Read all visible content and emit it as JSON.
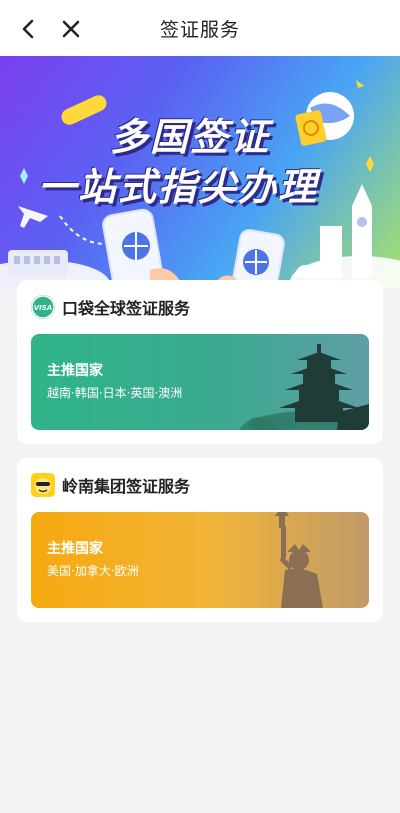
{
  "nav": {
    "title": "签证服务"
  },
  "banner": {
    "line1": "多国签证",
    "line2": "一站式指尖办理"
  },
  "cards": [
    {
      "name": "口袋全球签证服务",
      "logo_text": "VISA",
      "promo_title": "主推国家",
      "promo_countries": "越南·韩国·日本·英国·澳洲"
    },
    {
      "name": "岭南集团签证服务",
      "promo_title": "主推国家",
      "promo_countries": "美国·加拿大·欧洲"
    }
  ],
  "colors": {
    "card1_accent": "#2fb48a",
    "card2_accent": "#f7a90f"
  }
}
